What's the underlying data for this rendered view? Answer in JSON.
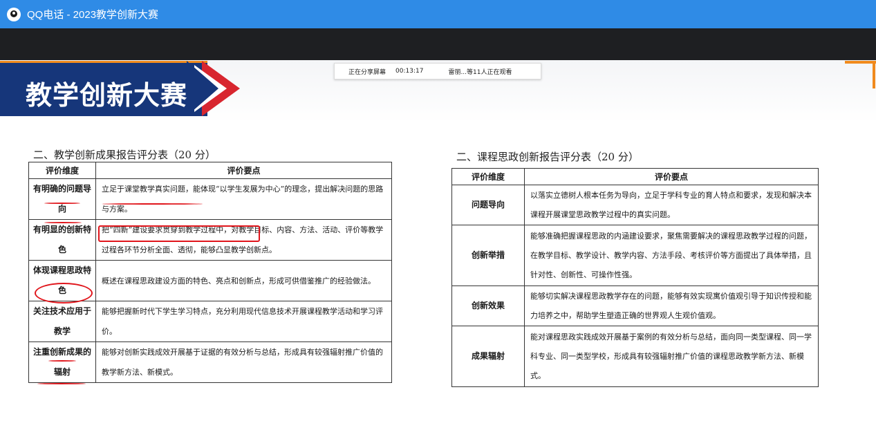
{
  "window": {
    "title": "QQ电话 - 2023教学创新大赛",
    "app_icon": "qq-penguin-icon"
  },
  "share_bar": {
    "status": "正在分享屏幕",
    "elapsed": "00:13:17",
    "viewers": "雷丽...等11人正在观看"
  },
  "slide": {
    "banner_title": "教学创新大赛",
    "colors": {
      "banner": "#16367a",
      "chevron": "#d8262f",
      "accent": "#f08a1c",
      "annotation": "#e0151b"
    },
    "table1": {
      "title": "二、教学创新成果报告评分表（20 分）",
      "headers": [
        "评价维度",
        "评价要点"
      ],
      "rows": [
        {
          "dimension": "有明确的问题导向",
          "point": "立足于课堂教学真实问题，能体现“以学生发展为中心”的理念，提出解决问题的思路与方案。"
        },
        {
          "dimension": "有明显的创新特色",
          "point": "把“四新”建设要求贯穿到教学过程中，对教学目标、内容、方法、活动、评价等教学过程各环节分析全面、透彻，能够凸显教学创新点。"
        },
        {
          "dimension": "体现课程思政特色",
          "point": "概述在课程思政建设方面的特色、亮点和创新点，形成可供借鉴推广的经验做法。"
        },
        {
          "dimension": "关注技术应用于教学",
          "point": "能够把握新时代下学生学习特点，充分利用现代信息技术开展课程教学活动和学习评价。"
        },
        {
          "dimension": "注重创新成果的辐射",
          "point": "能够对创新实践成效开展基于证据的有效分析与总结，形成具有较强辐射推广价值的教学新方法、新模式。"
        }
      ]
    },
    "table2": {
      "title": "二、课程思政创新报告评分表（20 分）",
      "headers": [
        "评价维度",
        "评价要点"
      ],
      "rows": [
        {
          "dimension": "问题导向",
          "point": "以落实立德树人根本任务为导向，立足于学科专业的育人特点和要求，发现和解决本课程开展课堂思政教学过程中的真实问题。"
        },
        {
          "dimension": "创新举措",
          "point": "能够准确把握课程思政的内涵建设要求，聚焦需要解决的课程思政教学过程的问题，在教学目标、教学设计、教学内容、方法手段、考核评价等方面提出了具体举措，且针对性、创新性、可操作性强。"
        },
        {
          "dimension": "创新效果",
          "point": "能够切实解决课程思政教学存在的问题，能够有效实现寓价值观引导于知识传授和能力培养之中，帮助学生塑造正确的世界观人生观价值观。"
        },
        {
          "dimension": "成果辐射",
          "point": "能对课程思政实践成效开展基于案例的有效分析与总结，面向同一类型课程、同一学科专业、同一类型学校，形成具有较强辐射推广价值的课程思政教学新方法、新模式。"
        }
      ]
    }
  }
}
